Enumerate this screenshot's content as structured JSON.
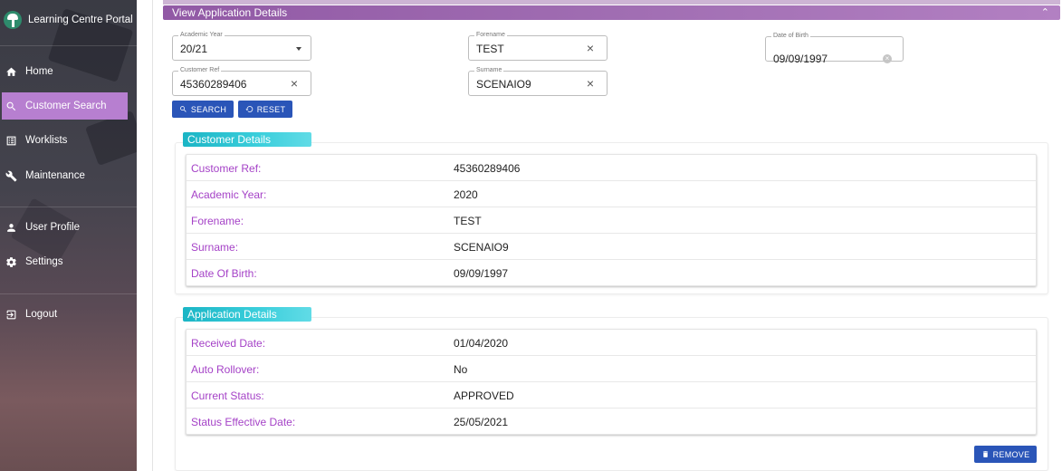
{
  "app": {
    "title": "Learning Centre Portal"
  },
  "sidebar": {
    "items": [
      {
        "label": "Home",
        "icon": "home-icon"
      },
      {
        "label": "Customer Search",
        "icon": "search-icon",
        "active": true
      },
      {
        "label": "Worklists",
        "icon": "list-icon"
      },
      {
        "label": "Maintenance",
        "icon": "wrench-icon"
      },
      {
        "label": "User Profile",
        "icon": "person-icon"
      },
      {
        "label": "Settings",
        "icon": "gear-icon"
      },
      {
        "label": "Logout",
        "icon": "logout-icon"
      }
    ]
  },
  "header": {
    "title": "View Application Details"
  },
  "search": {
    "academic_year": {
      "label": "Academic Year",
      "value": "20/21"
    },
    "forename": {
      "label": "Forename",
      "value": "TEST"
    },
    "dob": {
      "label": "Date of Birth",
      "value": "09/09/1997"
    },
    "customer_ref": {
      "label": "Customer Ref",
      "value": "45360289406"
    },
    "surname": {
      "label": "Surname",
      "value": "SCENAIO9"
    },
    "search_label": "SEARCH",
    "reset_label": "RESET"
  },
  "customer_details": {
    "title": "Customer Details",
    "rows": [
      {
        "key": "Customer Ref:",
        "value": "45360289406"
      },
      {
        "key": "Academic Year:",
        "value": "2020"
      },
      {
        "key": "Forename:",
        "value": "TEST"
      },
      {
        "key": "Surname:",
        "value": "SCENAIO9"
      },
      {
        "key": "Date Of Birth:",
        "value": "09/09/1997"
      }
    ]
  },
  "application_details": {
    "title": "Application Details",
    "rows": [
      {
        "key": "Received Date:",
        "value": "01/04/2020"
      },
      {
        "key": "Auto Rollover:",
        "value": "No"
      },
      {
        "key": "Current Status:",
        "value": "APPROVED"
      },
      {
        "key": "Status Effective Date:",
        "value": "25/05/2021"
      }
    ],
    "remove_label": "REMOVE"
  },
  "colors": {
    "accent_purple": "#a06db2",
    "active_nav": "#b77fd0",
    "label_purple": "#a542c7",
    "section_teal": "#1bb5c5",
    "button_blue": "#2a55b8"
  }
}
